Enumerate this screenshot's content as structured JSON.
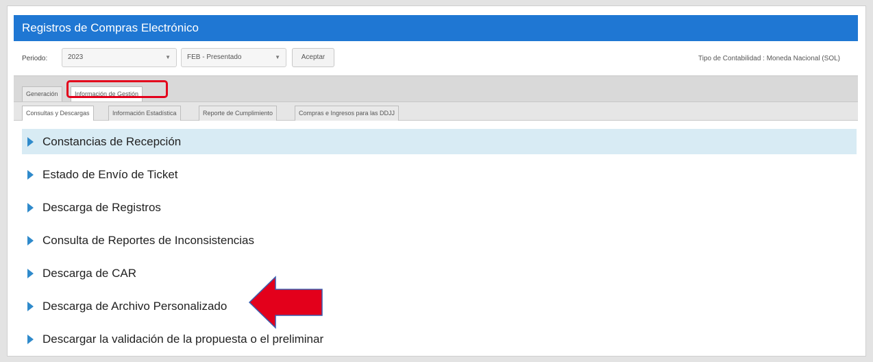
{
  "header": {
    "title": "Registros de Compras Electrónico"
  },
  "controls": {
    "periodo_label": "Periodo:",
    "year_value": "2023",
    "month_value": "FEB - Presentado",
    "accept_label": "Aceptar",
    "tipo_contabilidad": "Tipo de Contabilidad : Moneda Nacional (SOL)"
  },
  "tabs_primary": [
    {
      "label": "Generación"
    },
    {
      "label": "Información de Gestión"
    }
  ],
  "tabs_secondary": [
    {
      "label": "Consultas y Descargas"
    },
    {
      "label": "Información Estadística"
    },
    {
      "label": "Reporte de Cumplimiento"
    },
    {
      "label": "Compras e Ingresos para las DDJJ"
    }
  ],
  "menu": [
    {
      "label": "Constancias de Recepción"
    },
    {
      "label": "Estado de Envío  de Ticket"
    },
    {
      "label": "Descarga de Registros"
    },
    {
      "label": "Consulta de Reportes de  Inconsistencias"
    },
    {
      "label": "Descarga de CAR"
    },
    {
      "label": "Descarga de Archivo Personalizado"
    },
    {
      "label": "Descargar la validación de la propuesta o el preliminar"
    }
  ],
  "colors": {
    "header_bg": "#1f77d3",
    "highlight_row": "#d8ebf4",
    "annotation_red": "#e3001b",
    "triangle_blue": "#2f8acb"
  }
}
